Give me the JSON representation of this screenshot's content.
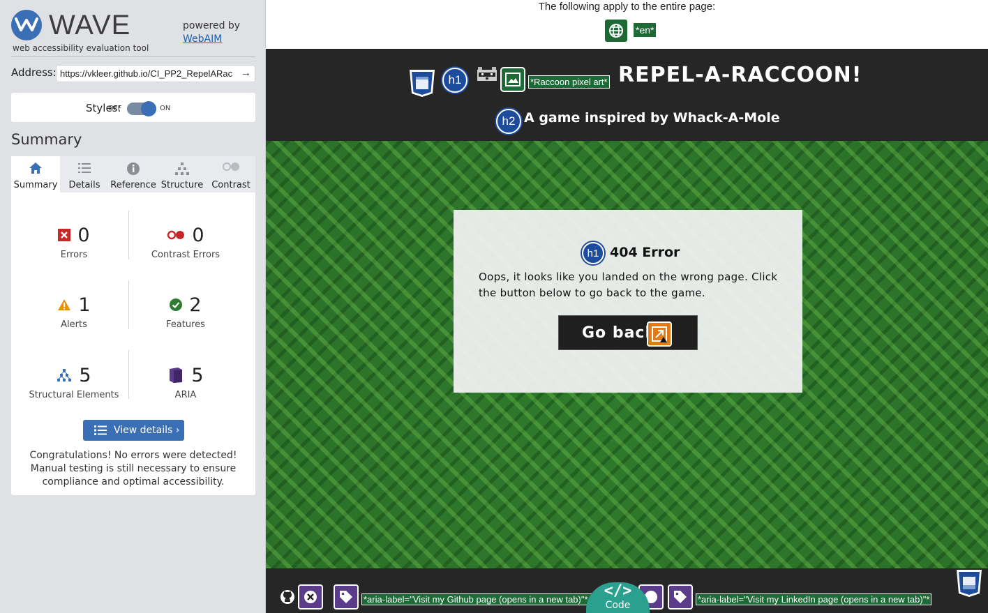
{
  "wave": {
    "logo_text": "WAVE",
    "logo_subtitle": "web accessibility evaluation tool",
    "powered_by": "powered by",
    "powered_link": "WebAIM",
    "address_label": "Address:",
    "address_value": "https://vkleer.github.io/CI_PP2_RepelARac",
    "address_go": "→",
    "styles_label": "Styles:",
    "styles_off": "OFF",
    "styles_on": "ON",
    "summary_heading": "Summary",
    "tabs": [
      {
        "label": "Summary",
        "icon": "home-icon"
      },
      {
        "label": "Details",
        "icon": "list-icon"
      },
      {
        "label": "Reference",
        "icon": "info-icon"
      },
      {
        "label": "Structure",
        "icon": "structure-icon"
      },
      {
        "label": "Contrast",
        "icon": "contrast-icon"
      }
    ],
    "stats": {
      "errors": {
        "count": "0",
        "label": "Errors"
      },
      "contrast_errors": {
        "count": "0",
        "label": "Contrast Errors"
      },
      "alerts": {
        "count": "1",
        "label": "Alerts"
      },
      "features": {
        "count": "2",
        "label": "Features"
      },
      "structural": {
        "count": "5",
        "label": "Structural Elements"
      },
      "aria": {
        "count": "5",
        "label": "ARIA"
      }
    },
    "view_details": "View details ›",
    "congrats": "Congratulations! No errors were detected! Manual testing is still necessary to ensure compliance and optimal accessibility.",
    "colors": {
      "accent": "#3b6fb5",
      "error": "#c62828",
      "alert": "#e8900c",
      "feature": "#2e7d32",
      "aria": "#5a3c8a"
    }
  },
  "page": {
    "applies_text": "The following apply to the entire page:",
    "lang_tag": "*en*",
    "h1_badge": "h1",
    "h2_badge": "h2",
    "alt_tag": "*Raccoon pixel art*",
    "site_title": "REPEL-A-RACCOON!",
    "site_subtitle": "A game inspired by Whack-A-Mole",
    "error_title": "404 Error",
    "error_text": "Oops, it looks like you landed on the wrong page. Click the button below to go back to the game.",
    "go_back": "Go back",
    "footer": {
      "aria_label_github": "*aria-label=\"Visit my Github page (opens in a new tab)\"*",
      "aria_label_linkedin": "*aria-label=\"Visit my LinkedIn page (opens in a new tab)\"*",
      "code_glyph": "</>",
      "code_label": "Code"
    }
  }
}
